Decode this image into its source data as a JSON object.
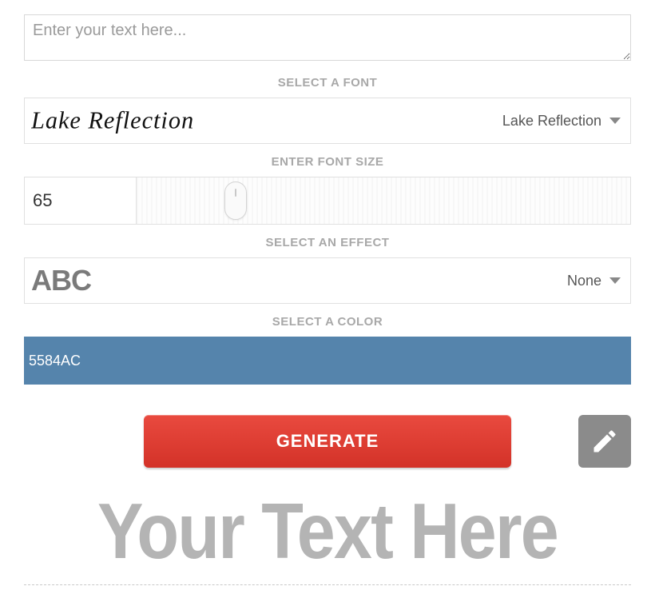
{
  "text_input": {
    "placeholder": "Enter your text here..."
  },
  "labels": {
    "font": "SELECT A FONT",
    "size": "ENTER FONT SIZE",
    "effect": "SELECT AN EFFECT",
    "color": "SELECT A COLOR"
  },
  "font": {
    "selected": "Lake Reflection",
    "preview": "Lake Reflection"
  },
  "size": {
    "value": "65"
  },
  "effect": {
    "selected": "None",
    "sample": "ABC"
  },
  "color": {
    "hex": "5584AC",
    "css": "#5584AC"
  },
  "actions": {
    "generate": "GENERATE"
  },
  "output": {
    "text": "Your Text Here"
  }
}
